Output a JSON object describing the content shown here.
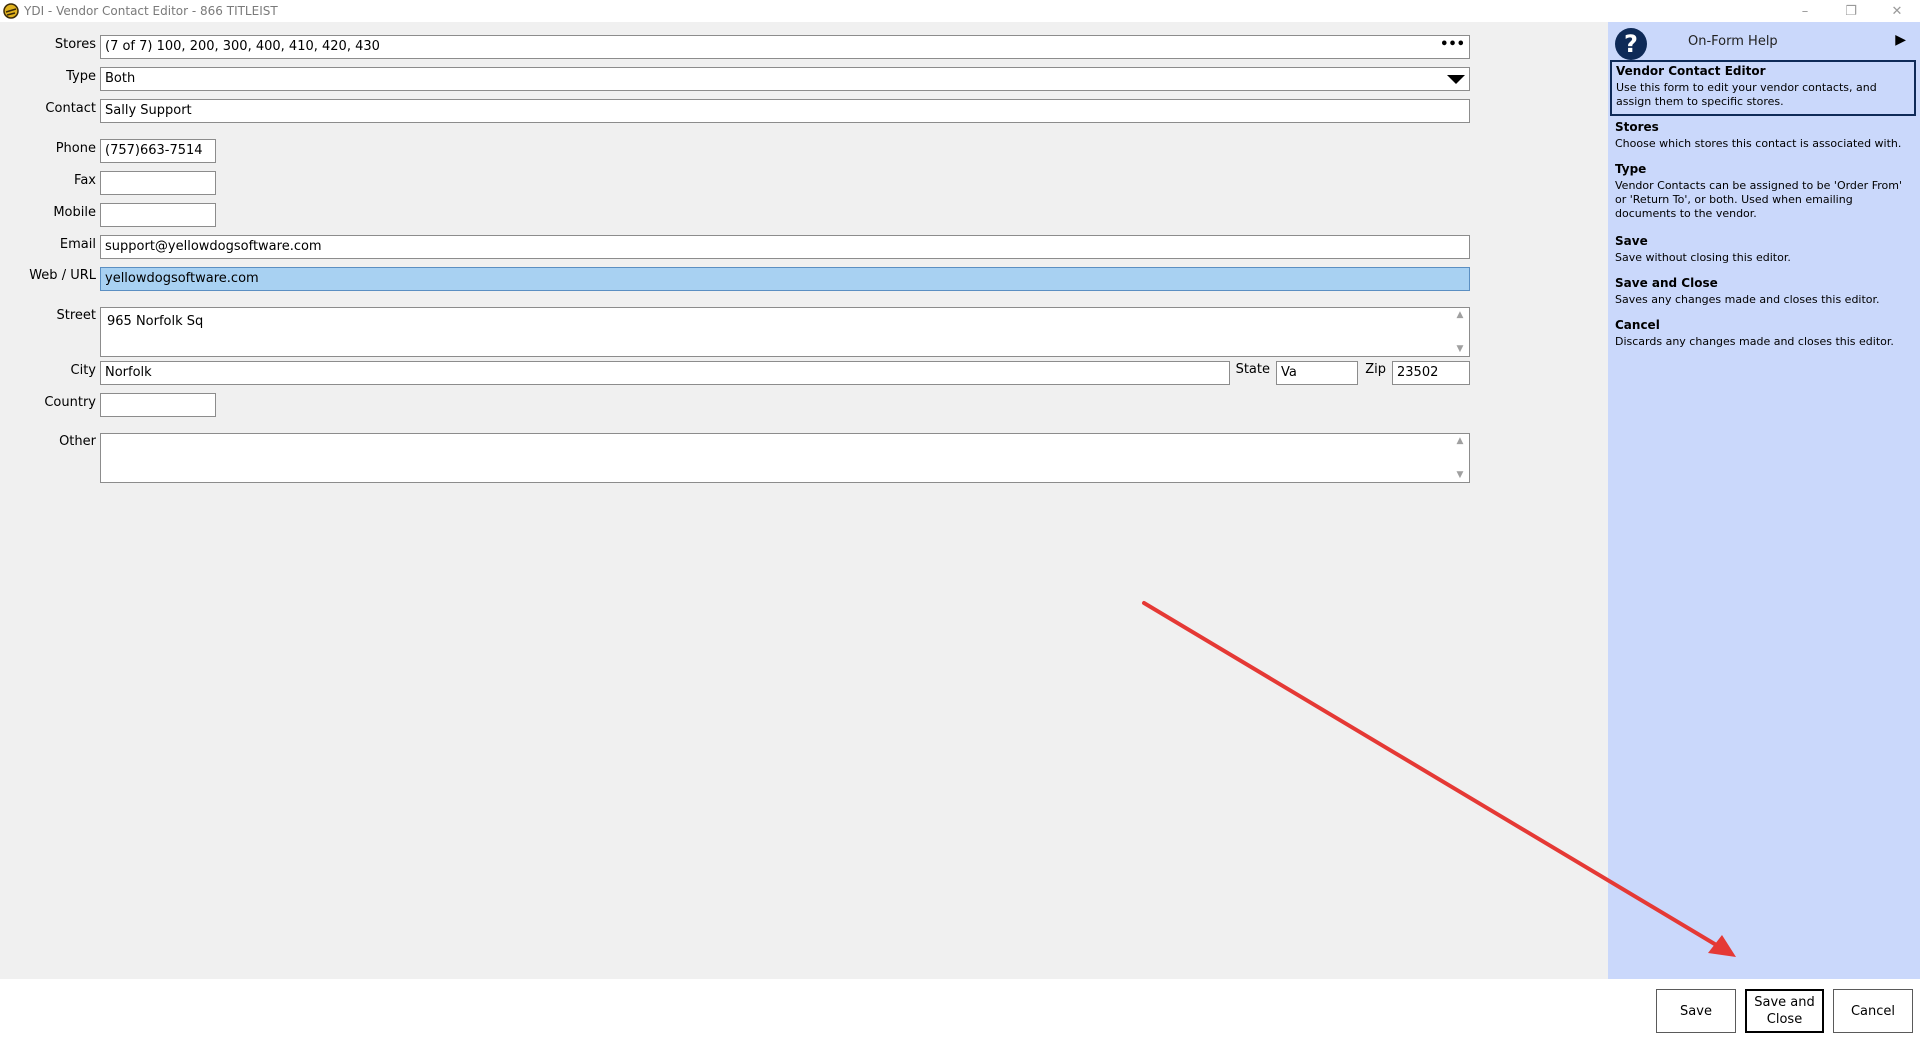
{
  "window": {
    "title": "YDI - Vendor Contact Editor - 866 TITLEIST",
    "minimize": "–",
    "restore": "❐",
    "close": "✕"
  },
  "form": {
    "stores": {
      "label": "Stores",
      "value": "(7 of 7) 100, 200, 300, 400, 410, 420, 430",
      "button": "•••"
    },
    "type": {
      "label": "Type",
      "value": "Both"
    },
    "contact": {
      "label": "Contact",
      "value": "Sally Support"
    },
    "phone": {
      "label": "Phone",
      "value": "(757)663-7514"
    },
    "fax": {
      "label": "Fax",
      "value": ""
    },
    "mobile": {
      "label": "Mobile",
      "value": ""
    },
    "email": {
      "label": "Email",
      "value": "support@yellowdogsoftware.com"
    },
    "web": {
      "label": "Web / URL",
      "value": "yellowdogsoftware.com"
    },
    "street": {
      "label": "Street",
      "value": "965 Norfolk Sq"
    },
    "city": {
      "label": "City",
      "value": "Norfolk"
    },
    "state": {
      "label": "State",
      "value": "Va"
    },
    "zip": {
      "label": "Zip",
      "value": "23502"
    },
    "country": {
      "label": "Country",
      "value": ""
    },
    "other": {
      "label": "Other",
      "value": ""
    }
  },
  "help": {
    "icon": "?",
    "title": "On-Form Help",
    "collapse_arrow": "▶",
    "intro": {
      "heading": "Vendor Contact Editor",
      "body": "Use this form to edit your vendor contacts, and assign them to specific stores."
    },
    "sections": [
      {
        "heading": "Stores",
        "body": "Choose which stores this contact is associated with."
      },
      {
        "heading": "Type",
        "body": "Vendor Contacts can be assigned to be 'Order From' or 'Return To', or both.  Used when emailing documents to the vendor."
      },
      {
        "heading": "Save",
        "body": "Save without closing this editor."
      },
      {
        "heading": "Save and Close",
        "body": "Saves any changes made and closes this editor."
      },
      {
        "heading": "Cancel",
        "body": "Discards any changes made and closes this editor."
      }
    ]
  },
  "buttons": {
    "save": "Save",
    "save_close_line1": "Save and",
    "save_close_line2": "Close",
    "cancel": "Cancel"
  },
  "colors": {
    "help_panel": "#cad8fb",
    "selection": "#a8d1f2",
    "annotation_arrow": "#e53935"
  }
}
